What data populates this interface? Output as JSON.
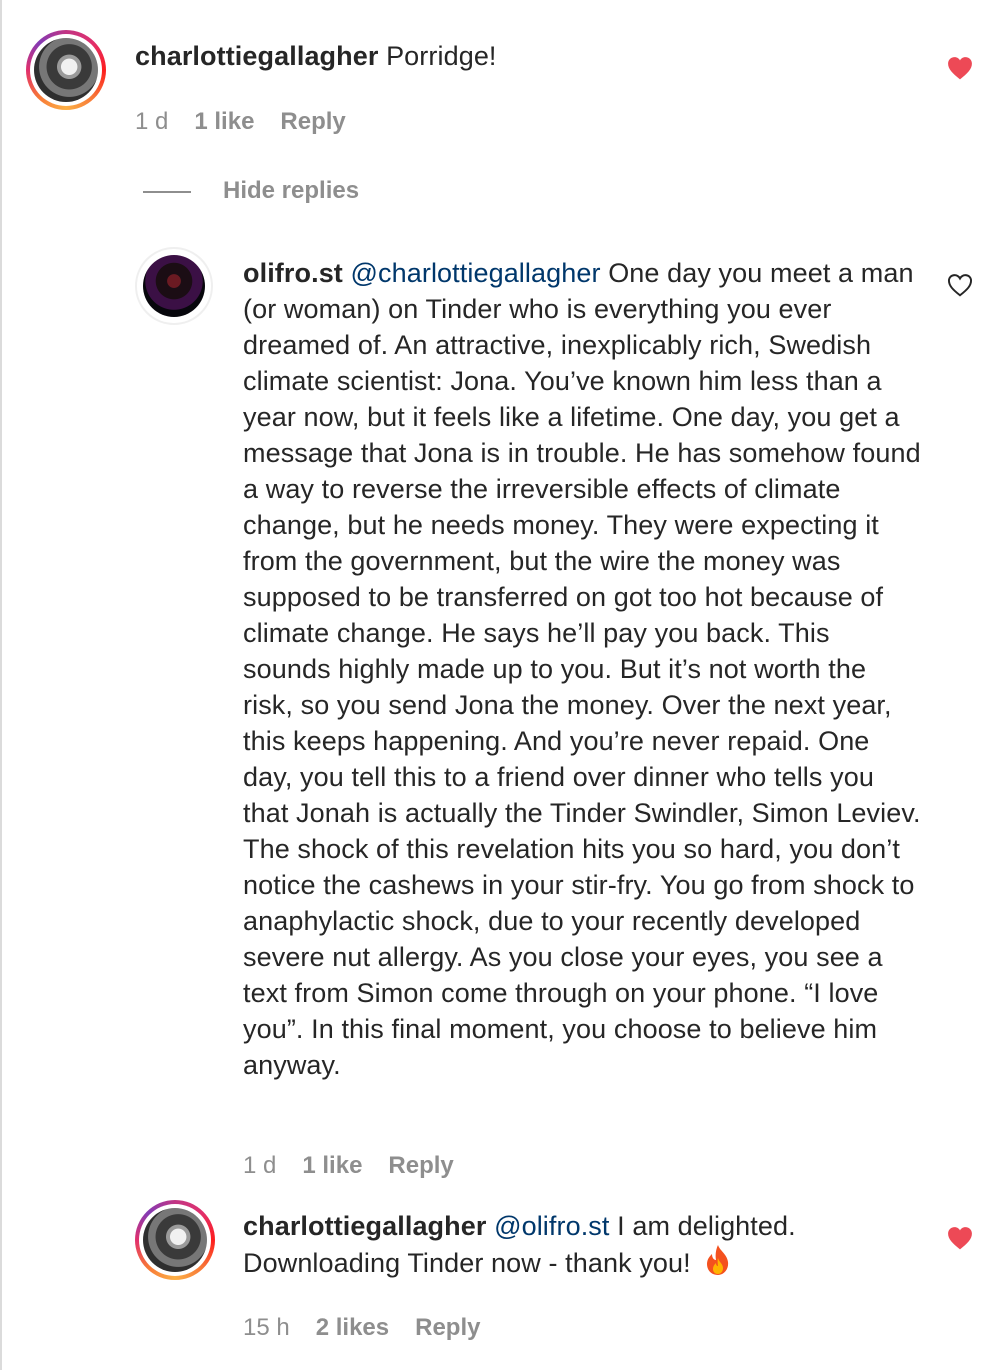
{
  "comments": [
    {
      "username": "charlottiegallagher",
      "mention": "",
      "text": "Porridge!",
      "time": "1 d",
      "likes": "1 like",
      "reply": "Reply",
      "liked": true
    },
    {
      "username": "olifro.st",
      "mention": "@charlottiegallagher",
      "text": "One day you meet a man (or woman) on Tinder who is everything you ever dreamed of. An attractive, inexplicably rich, Swedish climate scientist: Jona. You’ve known him less than a year now, but it feels like a lifetime. One day, you get a message that Jona is in trouble. He has somehow found a way to reverse the irreversible effects of climate change, but he needs money. They were expecting it from the government, but the wire the money was supposed to be transferred on got too hot because of climate change. He says he’ll pay you back. This sounds highly made up to you. But it’s not worth the risk, so you send Jona the money. Over the next year, this keeps happening. And you’re never repaid. One day, you tell this to a friend over dinner who tells you that Jonah is actually the Tinder Swindler, Simon Leviev. The shock of this revelation hits you so hard, you don’t notice the cashews in your stir-fry. You go from shock to anaphylactic shock, due to your recently developed severe nut allergy. As you close your eyes, you see a text from Simon come through on your phone. “I love you”. In this final moment, you choose to believe him anyway.",
      "time": "1 d",
      "likes": "1 like",
      "reply": "Reply",
      "liked": false
    },
    {
      "username": "charlottiegallagher",
      "mention": "@olifro.st",
      "text": "I am delighted. Downloading Tinder now - thank you!",
      "emoji": "fire-emoji",
      "time": "15 h",
      "likes": "2 likes",
      "reply": "Reply",
      "liked": true
    }
  ],
  "hide_replies": "Hide replies",
  "colors": {
    "heart_liked": "#ed4956",
    "mention": "#00376b",
    "meta": "#8e8e8e"
  }
}
